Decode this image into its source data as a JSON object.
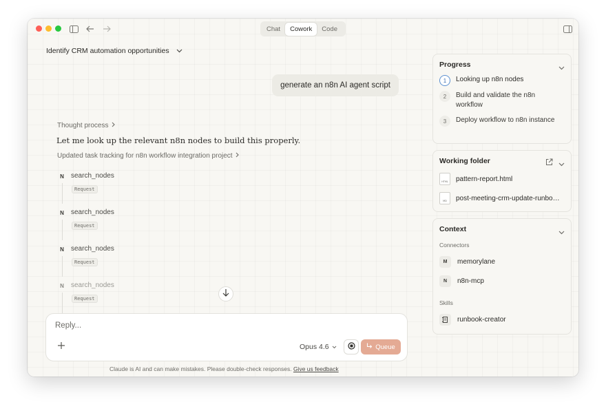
{
  "titlebar": {
    "tabs": [
      {
        "label": "Chat",
        "active": false
      },
      {
        "label": "Cowork",
        "active": true
      },
      {
        "label": "Code",
        "active": false
      }
    ]
  },
  "conversation": {
    "title": "Identify CRM automation opportunities",
    "user_message": "generate an n8n AI agent script",
    "thought_process": "Thought process",
    "assistant_text": "Let me look up the relevant n8n nodes to build this properly.",
    "task_update": "Updated task tracking for n8n workflow integration project",
    "tool_calls": [
      {
        "badge": "N",
        "name": "search_nodes",
        "request": "Request"
      },
      {
        "badge": "N",
        "name": "search_nodes",
        "request": "Request"
      },
      {
        "badge": "N",
        "name": "search_nodes",
        "request": "Request"
      },
      {
        "badge": "N",
        "name": "search_nodes",
        "request": "Request"
      }
    ]
  },
  "composer": {
    "placeholder": "Reply...",
    "model": "Opus 4.6",
    "queue_label": "Queue",
    "disclaimer": "Claude is AI and can make mistakes. Please double-check responses.",
    "feedback_link": "Give us feedback"
  },
  "progress": {
    "title": "Progress",
    "steps": [
      {
        "num": "1",
        "label": "Looking up n8n nodes",
        "current": true
      },
      {
        "num": "2",
        "label": "Build and validate the n8n workflow",
        "current": false
      },
      {
        "num": "3",
        "label": "Deploy workflow to n8n instance",
        "current": false
      }
    ]
  },
  "working_folder": {
    "title": "Working folder",
    "files": [
      {
        "name": "pattern-report.html",
        "type": "HTML"
      },
      {
        "name": "post-meeting-crm-update-runbook.md",
        "type": "MD"
      }
    ]
  },
  "context": {
    "title": "Context",
    "connectors_label": "Connectors",
    "connectors": [
      {
        "badge": "M",
        "name": "memorylane"
      },
      {
        "badge": "N",
        "name": "n8n-mcp"
      }
    ],
    "skills_label": "Skills",
    "skills": [
      {
        "name": "runbook-creator"
      }
    ]
  },
  "colors": {
    "accent": "#e4aa94",
    "current_step": "#5a8fd0"
  }
}
